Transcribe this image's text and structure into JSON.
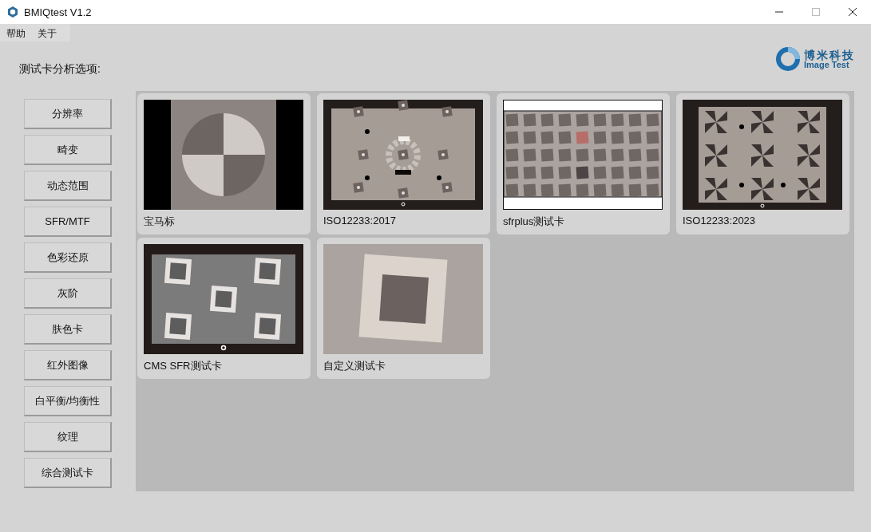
{
  "window": {
    "title": "BMIQtest V1.2"
  },
  "menu": [
    "帮助",
    "关于"
  ],
  "logo": {
    "name": "博米科技",
    "subtitle": "Image Test"
  },
  "section_label": "测试卡分析选项:",
  "sidebar_buttons": [
    "分辨率",
    "畸变",
    "动态范围",
    "SFR/MTF",
    "色彩还原",
    "灰阶",
    "肤色卡",
    "红外图像",
    "白平衡/均衡性",
    "纹理",
    "综合测试卡"
  ],
  "charts": [
    {
      "label": "宝马标",
      "kind": "bmw"
    },
    {
      "label": "ISO12233:2017",
      "kind": "iso2017"
    },
    {
      "label": "sfrplus测试卡",
      "kind": "sfrplus"
    },
    {
      "label": "ISO12233:2023",
      "kind": "iso2023"
    },
    {
      "label": "CMS SFR测试卡",
      "kind": "cms"
    },
    {
      "label": "自定义测试卡",
      "kind": "custom"
    }
  ]
}
